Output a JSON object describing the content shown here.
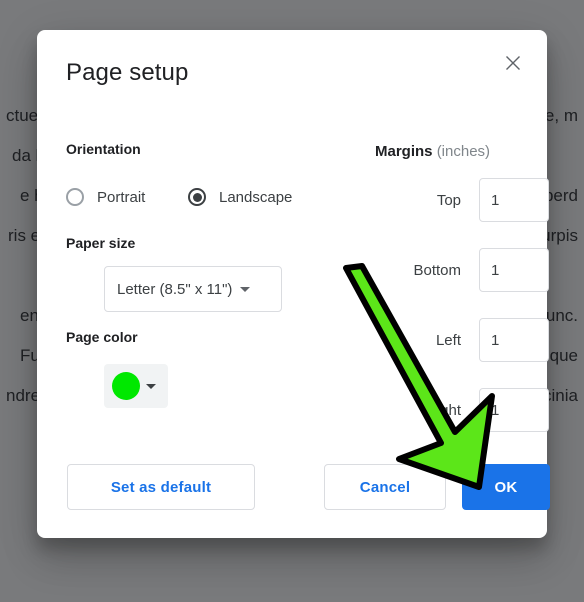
{
  "background_document": {
    "lines": [
      "ctuer a",
      "da libe",
      "e habi",
      "ris et",
      "",
      "endiss",
      " Fusce",
      "ndrerit"
    ],
    "lines_right": [
      "re, m",
      "",
      "nperd",
      "urpis",
      "",
      "unc. ",
      "sque",
      "cinia"
    ]
  },
  "dialog": {
    "title": "Page setup",
    "close_icon": "close-icon",
    "orientation": {
      "label": "Orientation",
      "options": [
        {
          "label": "Portrait",
          "selected": false
        },
        {
          "label": "Landscape",
          "selected": true
        }
      ]
    },
    "paper_size": {
      "label": "Paper size",
      "value": "Letter (8.5\" x 11\")",
      "caret_icon": "chevron-down-icon"
    },
    "page_color": {
      "label": "Page color",
      "swatch_color": "#00e800",
      "caret_icon": "chevron-down-icon"
    },
    "margins": {
      "heading_strong": "Margins",
      "heading_muted": "(inches)",
      "fields": [
        {
          "label": "Top",
          "value": "1"
        },
        {
          "label": "Bottom",
          "value": "1"
        },
        {
          "label": "Left",
          "value": "1"
        },
        {
          "label": "Right",
          "value": "1"
        }
      ]
    },
    "footer": {
      "set_as_default_label": "Set as default",
      "cancel_label": "Cancel",
      "ok_label": "OK"
    }
  },
  "annotation": {
    "arrow_fill": "#5ce619",
    "arrow_stroke": "#000000",
    "points_to": "ok-button"
  },
  "colors": {
    "accent_blue": "#1a73e8",
    "text_primary": "#202124",
    "text_secondary": "#3c4043",
    "text_muted": "#80868b",
    "border": "#dadce0",
    "scrim": "rgba(32,33,36,0.60)"
  }
}
